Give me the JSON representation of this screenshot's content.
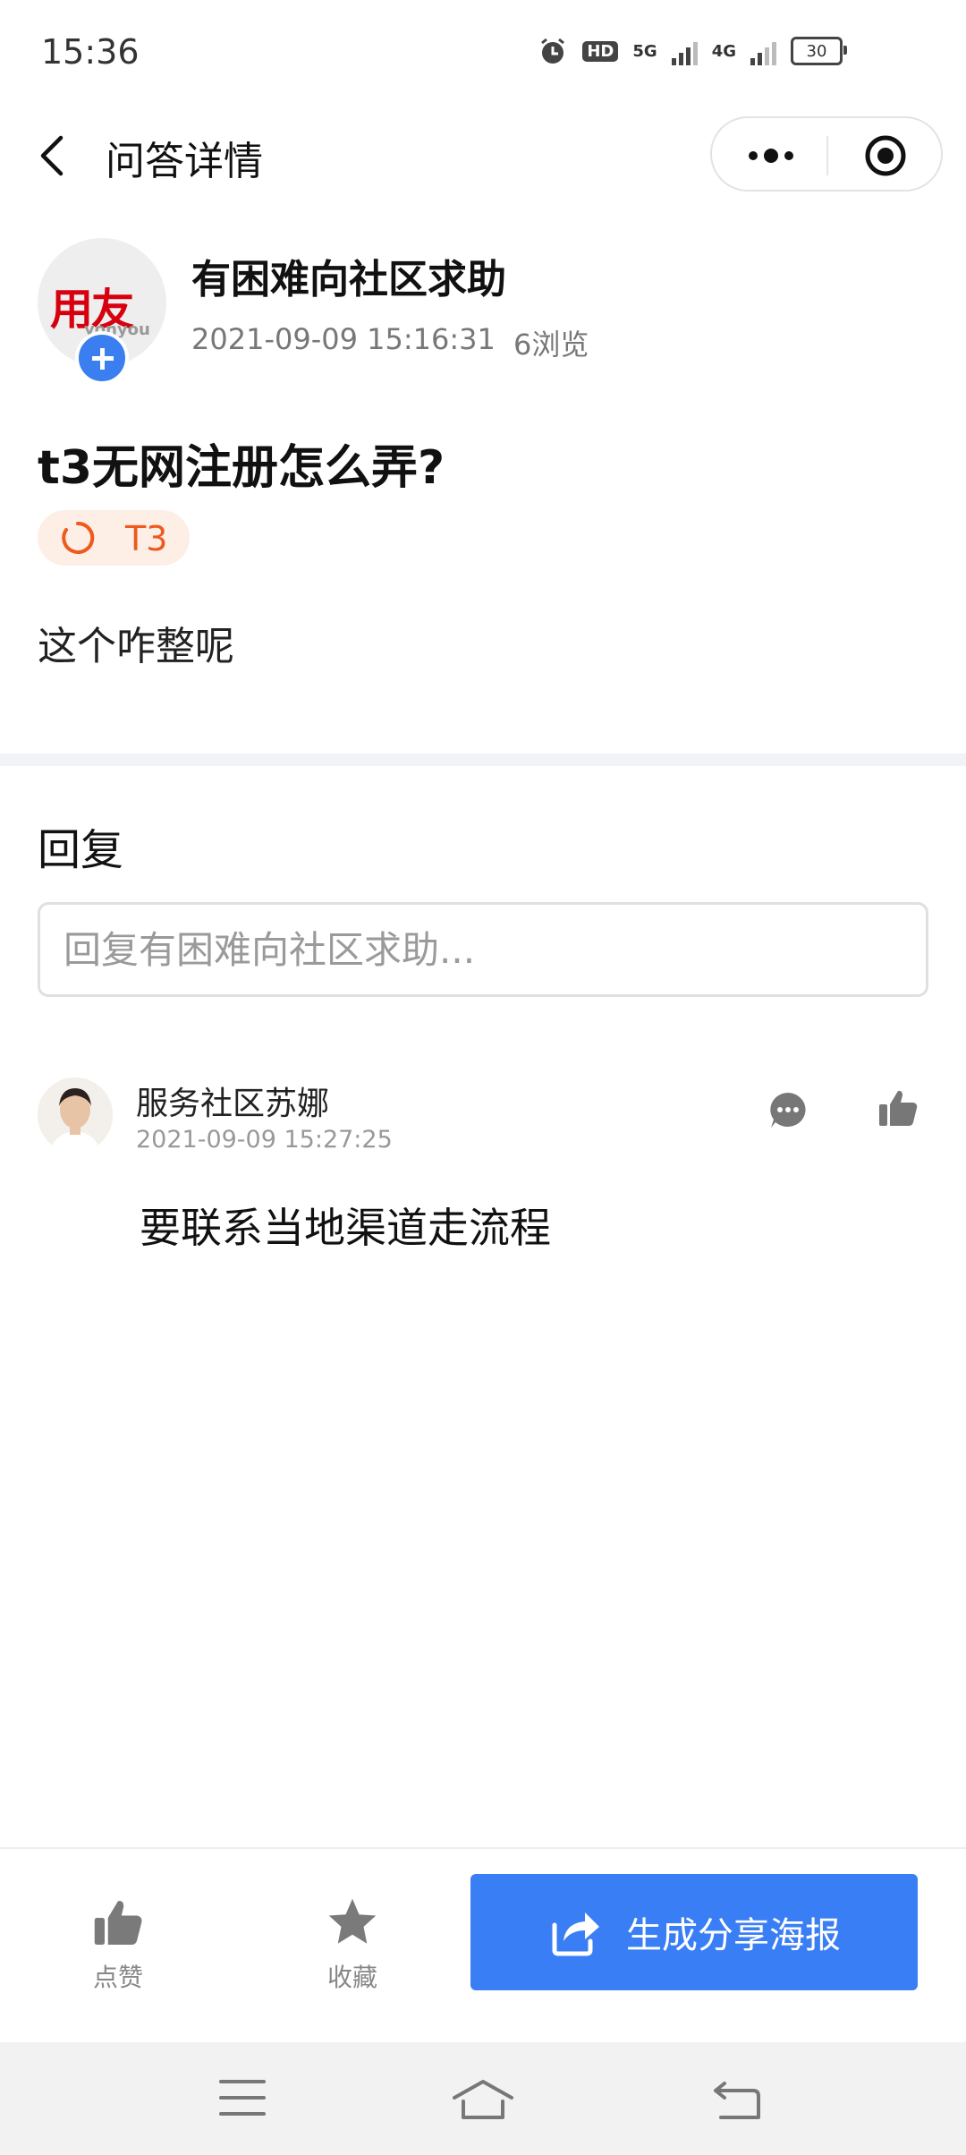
{
  "status_bar": {
    "time": "15:36",
    "hd_label": "HD",
    "net_5g": "5G",
    "net_4g": "4G",
    "battery": "30"
  },
  "nav": {
    "title": "问答详情"
  },
  "post": {
    "author_name": "有困难向社区求助",
    "avatar_logo_text": "用友",
    "avatar_logo_sub": "yonyou",
    "time": "2021-09-09 15:16:31",
    "views": "6浏览",
    "title": "t3无网注册怎么弄?",
    "tag": "T3",
    "body": "这个咋整呢"
  },
  "reply": {
    "heading": "回复",
    "placeholder": "回复有困难向社区求助..."
  },
  "comments": [
    {
      "author": "服务社区苏娜",
      "time": "2021-09-09 15:27:25",
      "text": "要联系当地渠道走流程"
    }
  ],
  "bottom_bar": {
    "like_label": "点赞",
    "favorite_label": "收藏",
    "share_label": "生成分享海报"
  },
  "colors": {
    "primary": "#3a7ef6",
    "tag_text": "#ee5a1c",
    "tag_bg": "#fdeee6",
    "logo_red": "#d7000f"
  }
}
